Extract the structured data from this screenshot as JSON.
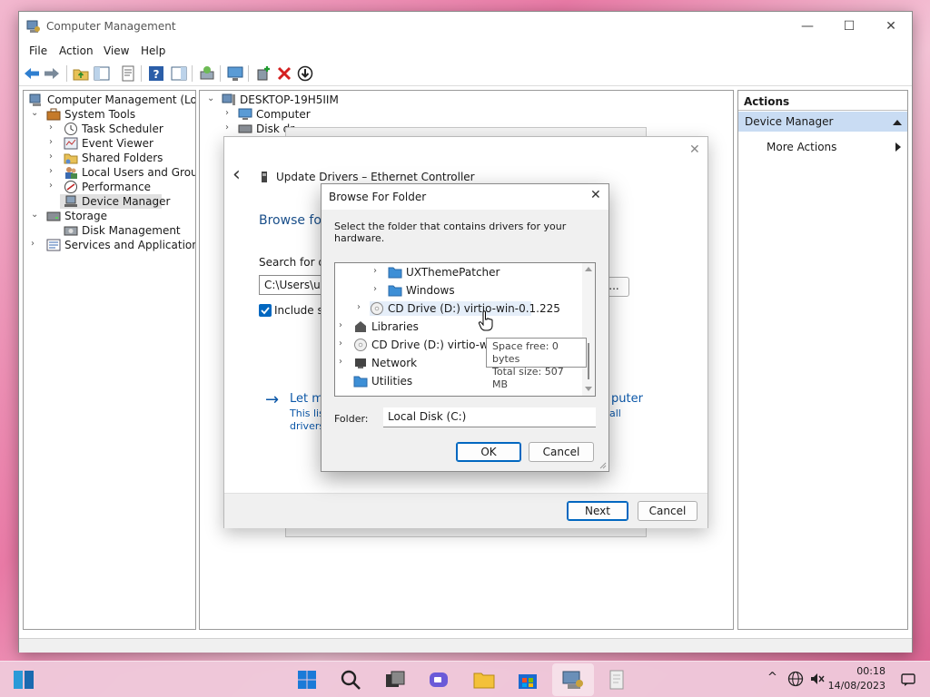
{
  "window": {
    "title": "Computer Management",
    "menu": [
      "File",
      "Action",
      "View",
      "Help"
    ],
    "controls": {
      "minimize": "—",
      "maximize": "☐",
      "close": "✕"
    }
  },
  "tree": {
    "root": "Computer Management (Local)",
    "system_tools": "System Tools",
    "task_scheduler": "Task Scheduler",
    "event_viewer": "Event Viewer",
    "shared_folders": "Shared Folders",
    "local_users": "Local Users and Groups",
    "performance": "Performance",
    "device_manager": "Device Manager",
    "storage": "Storage",
    "disk_management": "Disk Management",
    "services": "Services and Applications"
  },
  "devices": {
    "host": "DESKTOP-19H5IIM",
    "computer": "Computer",
    "disk_drives": "Disk dr"
  },
  "actions": {
    "header": "Actions",
    "section": "Device Manager",
    "more": "More Actions"
  },
  "wizard": {
    "title": "Update Drivers – Ethernet Controller",
    "heading": "Browse fo",
    "search_label": "Search for dri",
    "path_value": "C:\\Users\\use",
    "browse_label": "...",
    "include_label": "Include su",
    "let_me": "Let m",
    "let_me_tail": "puter",
    "desc1": "This lis",
    "desc1_tail": "all",
    "desc2": "drivers",
    "next": "Next",
    "cancel": "Cancel",
    "close": "✕",
    "back": "‹"
  },
  "browse": {
    "title": "Browse For Folder",
    "prompt": "Select the folder that contains drivers for your hardware.",
    "items": [
      "UXThemePatcher",
      "Windows",
      "CD Drive (D:) virtio-win-0.1.225",
      "Libraries",
      "CD Drive (D:) virtio-win-c",
      "Network",
      "Utilities"
    ],
    "tooltip_free": "Space free: 0 bytes",
    "tooltip_total": "Total size: 507 MB",
    "folder_label": "Folder:",
    "folder_value": "Local Disk (C:)",
    "ok": "OK",
    "cancel": "Cancel",
    "close": "✕"
  },
  "tray": {
    "time": "00:18",
    "date": "14/08/2023"
  },
  "colors": {
    "accent": "#0067c0",
    "selection": "#c9dcf3",
    "link": "#0b57a8",
    "folder": "#3d8fd6"
  }
}
